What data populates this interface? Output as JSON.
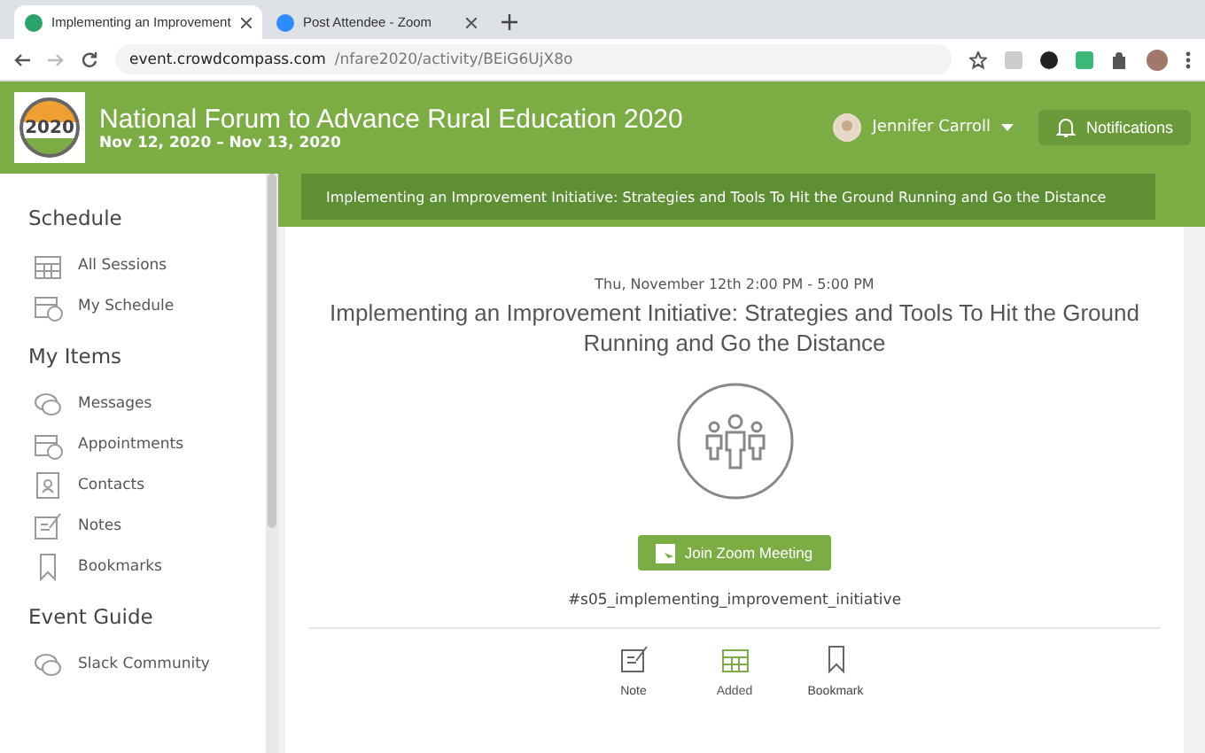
{
  "browser": {
    "tabs": [
      {
        "title": "Implementing an Improvement",
        "selected": true
      },
      {
        "title": "Post Attendee - Zoom",
        "selected": false
      }
    ],
    "url_host": "event.crowdcompass.com",
    "url_path": "/nfare2020/activity/BEiG6UjX8o"
  },
  "header": {
    "logo_text": "2020",
    "title": "National Forum to Advance Rural Education 2020",
    "dates": "Nov 12, 2020 – Nov 13, 2020",
    "user": "Jennifer Carroll",
    "notifications": "Notifications"
  },
  "banner": "Implementing an Improvement Initiative: Strategies and Tools To Hit the Ground Running and Go the Distance",
  "sidebar": {
    "sections": [
      {
        "title": "Schedule",
        "items": [
          {
            "label": "All Sessions",
            "kind": "calendar"
          },
          {
            "label": "My Schedule",
            "kind": "schedule"
          }
        ]
      },
      {
        "title": "My Items",
        "items": [
          {
            "label": "Messages",
            "kind": "messages"
          },
          {
            "label": "Appointments",
            "kind": "schedule"
          },
          {
            "label": "Contacts",
            "kind": "contact"
          },
          {
            "label": "Notes",
            "kind": "note"
          },
          {
            "label": "Bookmarks",
            "kind": "bookmark"
          }
        ]
      },
      {
        "title": "Event Guide",
        "items": [
          {
            "label": "Slack Community",
            "kind": "messages"
          }
        ]
      }
    ]
  },
  "session": {
    "time": "Thu, November 12th 2:00 PM - 5:00 PM",
    "title": "Implementing an Improvement Initiative: Strategies and Tools To Hit the Ground Running and Go the Distance",
    "join_button": "Join Zoom Meeting",
    "tag": "#s05_implementing_improvement_initiative",
    "actions": [
      {
        "label": "Note",
        "kind": "note",
        "active": false
      },
      {
        "label": "Added",
        "kind": "calendar",
        "active": true
      },
      {
        "label": "Bookmark",
        "kind": "bookmark",
        "active": false
      }
    ]
  }
}
